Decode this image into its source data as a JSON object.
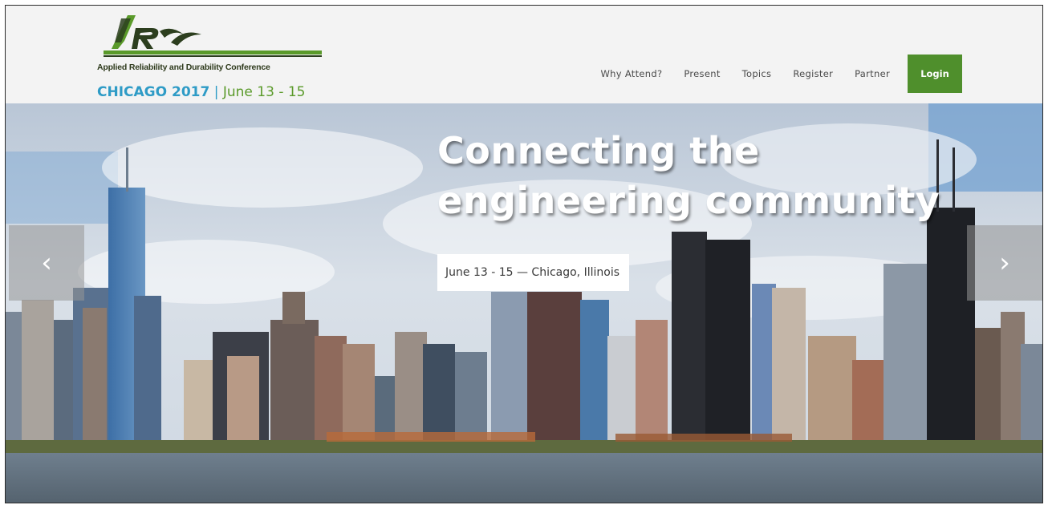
{
  "brand": {
    "logo_mark": "ARDC",
    "full_name": "Applied Reliability and Durability Conference",
    "city_year": "CHICAGO 2017",
    "separator": "|",
    "dates": "June 13 - 15",
    "colors": {
      "city": "#2e9bc6",
      "dates": "#5a9a2a",
      "logo_bar": "#4f8f2c"
    }
  },
  "nav": {
    "items": [
      {
        "label": "Why Attend?"
      },
      {
        "label": "Present"
      },
      {
        "label": "Topics"
      },
      {
        "label": "Register"
      },
      {
        "label": "Partner"
      }
    ],
    "login_label": "Login",
    "login_color": "#4f8f2c"
  },
  "hero": {
    "title_line1": "Connecting the",
    "title_line2": "engineering community",
    "subtitle": "June 13 - 15 — Chicago, Illinois",
    "image_icon": "chicago-skyline-photo",
    "prev_icon": "chevron-left-icon",
    "next_icon": "chevron-right-icon",
    "prev_glyph": "‹",
    "next_glyph": "›"
  }
}
